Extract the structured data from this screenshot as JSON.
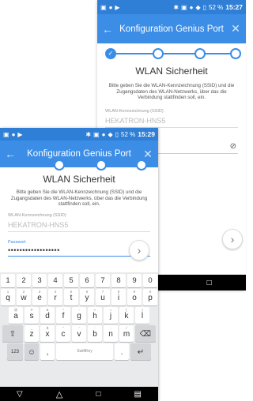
{
  "back": {
    "status": {
      "time": "15:27",
      "battery": "52 %"
    },
    "appbar": {
      "title": "Konfiguration Genius Port"
    },
    "heading": "WLAN Sicherheit",
    "description": "Bitte geben Sie die WLAN-Kennzeichnung (SSID) und die Zugangsdaten des WLAN-Netzwerks, über das die Verbindung stattfinden soll, ein.",
    "ssid_label": "WLAN-Kennzeichnung (SSID)",
    "ssid_value": "HEKATRON-HNS5"
  },
  "front": {
    "status": {
      "time": "15:29",
      "battery": "52 %"
    },
    "appbar": {
      "title": "Konfiguration Genius Port"
    },
    "heading": "WLAN Sicherheit",
    "description": "Bitte geben Sie die WLAN-Kennzeichnung (SSID) und die Zugangsdaten des WLAN-Netzwerks, über das die Verbindung stattfinden soll, ein.",
    "ssid_label": "WLAN-Kennzeichnung (SSID)",
    "ssid_value": "HEKATRON-HNS5",
    "password_label": "Passwort",
    "password_value": "••••••••••••••••••"
  },
  "keyboard": {
    "numbers": [
      "1",
      "2",
      "3",
      "4",
      "5",
      "6",
      "7",
      "8",
      "9",
      "0"
    ],
    "row1": [
      {
        "k": "q",
        "s": "1"
      },
      {
        "k": "w",
        "s": "2"
      },
      {
        "k": "e",
        "s": "3"
      },
      {
        "k": "r",
        "s": "4"
      },
      {
        "k": "t",
        "s": "5"
      },
      {
        "k": "y",
        "s": "6"
      },
      {
        "k": "u",
        "s": "7"
      },
      {
        "k": "i",
        "s": "8"
      },
      {
        "k": "o",
        "s": "9"
      },
      {
        "k": "p",
        "s": "0"
      }
    ],
    "row2": [
      {
        "k": "a",
        "s": "@"
      },
      {
        "k": "s",
        "s": "#"
      },
      {
        "k": "d",
        "s": "&"
      },
      {
        "k": "f",
        "s": "*"
      },
      {
        "k": "g",
        "s": "-"
      },
      {
        "k": "h",
        "s": "+"
      },
      {
        "k": "j",
        "s": "="
      },
      {
        "k": "k",
        "s": "("
      },
      {
        "k": "l",
        "s": ")"
      }
    ],
    "row3": [
      {
        "k": "z",
        "s": "_"
      },
      {
        "k": "x",
        "s": "$"
      },
      {
        "k": "c",
        "s": "\""
      },
      {
        "k": "v",
        "s": "'"
      },
      {
        "k": "b",
        "s": ":"
      },
      {
        "k": "n",
        "s": ";"
      },
      {
        "k": "m",
        "s": "/"
      }
    ],
    "symbols_label": "123",
    "space_label": "SwiftKey",
    "comma": ",",
    "period": "."
  }
}
